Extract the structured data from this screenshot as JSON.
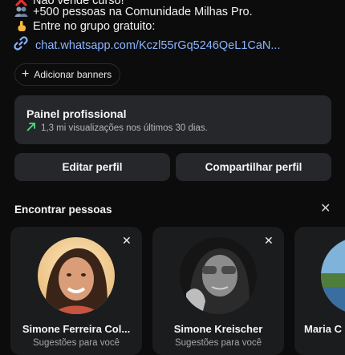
{
  "bio": {
    "line1_icon": "cross-mark-icon",
    "line1_text": "Não vende curso!",
    "line2_icon": "people-icon",
    "line2_text": "+500 pessoas na Comunidade Milhas Pro.",
    "line3_icon": "pointing-down-icon",
    "line3_text": "Entre no grupo gratuito:"
  },
  "link": {
    "icon": "link-icon",
    "url": "chat.whatsapp.com/Kczl55rGq5246QeL1CaN..."
  },
  "banners": {
    "label": "Adicionar banners"
  },
  "professional_panel": {
    "title": "Painel profissional",
    "subtitle": "1,3 mi visualizações nos últimos 30 dias.",
    "accent": "#4ade80"
  },
  "actions": {
    "edit_profile": "Editar perfil",
    "share_profile": "Compartilhar perfil"
  },
  "suggestions": {
    "title": "Encontrar pessoas",
    "cards": [
      {
        "name": "Simone Ferreira Col...",
        "subtitle": "Sugestões para você"
      },
      {
        "name": "Simone Kreischer",
        "subtitle": "Sugestões para você"
      },
      {
        "name": "Maria C",
        "subtitle": ""
      }
    ]
  },
  "colors": {
    "background": "#0c0c0d",
    "card": "#26272a",
    "link": "#8ab4ff"
  }
}
